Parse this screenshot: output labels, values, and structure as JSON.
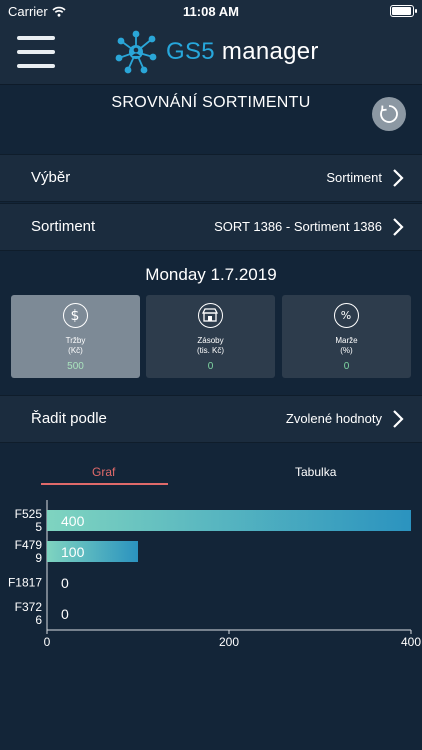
{
  "status": {
    "carrier": "Carrier",
    "time": "11:08 AM"
  },
  "header": {
    "title_prefix": "GS5",
    "title_rest": " manager"
  },
  "section_title": "SROVNÁNÍ SORTIMENTU",
  "rows": {
    "vyber": {
      "label": "Výběr",
      "value": "Sortiment"
    },
    "sortiment": {
      "label": "Sortiment",
      "value": "SORT 1386 - Sortiment 1386"
    },
    "sort_by": {
      "label": "Řadit podle",
      "value": "Zvolené hodnoty"
    }
  },
  "date": "Monday 1.7.2019",
  "tiles": [
    {
      "title": "Tržby",
      "unit": "(Kč)",
      "value": "500",
      "icon": "dollar-icon",
      "active": true
    },
    {
      "title": "Zásoby",
      "unit": "(tis. Kč)",
      "value": "0",
      "icon": "store-icon",
      "active": false
    },
    {
      "title": "Marže",
      "unit": "(%)",
      "value": "0",
      "icon": "percent-icon",
      "active": false
    }
  ],
  "tabs": {
    "graf": "Graf",
    "tabulka": "Tabulka"
  },
  "colors": {
    "accent_blue": "#27a7dc",
    "active_tab": "#e06a6a",
    "tile_value": "#7fd6a2",
    "bar_start": "#7fd4c0",
    "bar_end": "#2b93bf"
  },
  "chart_data": {
    "type": "bar",
    "orientation": "horizontal",
    "categories": [
      "F525\n5",
      "F479\n9",
      "F1817",
      "F372\n6"
    ],
    "values": [
      400,
      100,
      0,
      0
    ],
    "value_labels": [
      "400",
      "100",
      "0",
      "0"
    ],
    "xlim": [
      0,
      400
    ],
    "xticks": [
      0,
      200,
      400
    ]
  }
}
